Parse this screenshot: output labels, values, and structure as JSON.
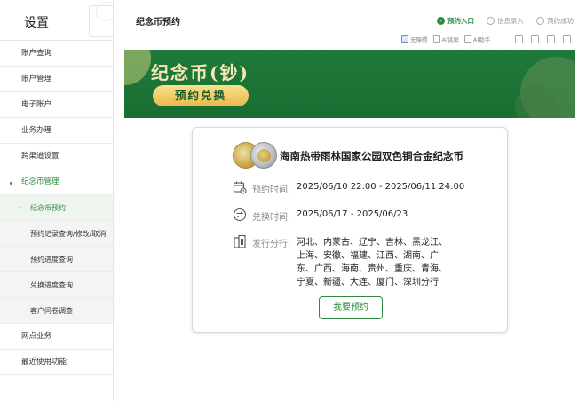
{
  "sidebar": {
    "title": "设置",
    "items": [
      {
        "label": "账户查询"
      },
      {
        "label": "账户管理"
      },
      {
        "label": "电子账户"
      },
      {
        "label": "业务办理"
      },
      {
        "label": "跨渠道设置"
      },
      {
        "label": "纪念币管理"
      }
    ],
    "sub_items": [
      {
        "label": "纪念币预约"
      },
      {
        "label": "预约记录查询/修改/取消"
      },
      {
        "label": "预约进度查询"
      },
      {
        "label": "兑换进度查询"
      },
      {
        "label": "客户问卷调查"
      }
    ],
    "bottom_items": [
      {
        "label": "网点业务"
      },
      {
        "label": "最近使用功能"
      }
    ]
  },
  "header": {
    "title": "纪念币预约",
    "steps": [
      {
        "label": "预约入口",
        "active": true
      },
      {
        "label": "信息录入",
        "active": false
      },
      {
        "label": "预约成功",
        "active": false
      }
    ],
    "toolbar": [
      {
        "label": "无障碍"
      },
      {
        "label": "AI读屏"
      },
      {
        "label": "AI助手"
      }
    ]
  },
  "banner": {
    "title": "纪念币(钞)",
    "button": "预约兑换"
  },
  "card": {
    "coin_name": "海南热带雨林国家公园双色铜合金纪念币",
    "reserve_label": "预约时间:",
    "reserve_time": "2025/06/10 22:00 - 2025/06/11 24:00",
    "exchange_label": "兑换时间:",
    "exchange_time": "2025/06/17 - 2025/06/23",
    "branch_label": "发行分行:",
    "branches": "河北、内蒙古、辽宁、吉林、黑龙江、上海、安徽、福建、江西、湖南、广东、广西、海南、贵州、重庆、青海、宁夏、新疆、大连、厦门、深圳分行",
    "button": "我要预约"
  },
  "colors": {
    "accent": "#2f8a3f",
    "banner_green": "#1f7a3a",
    "gold": "#f4e7b6"
  }
}
